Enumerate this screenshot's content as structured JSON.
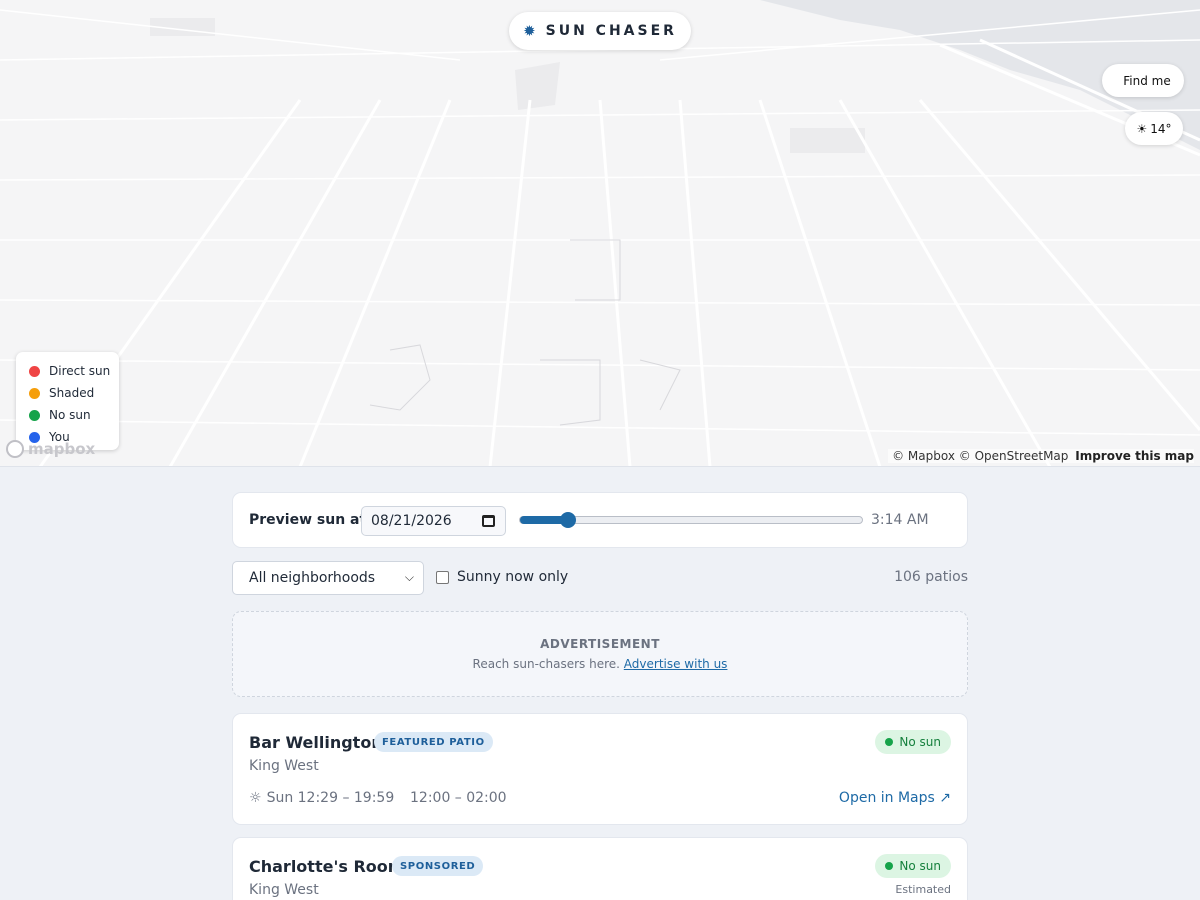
{
  "map": {
    "brand": {
      "icon": "sun-icon",
      "title": "SUN CHASER"
    },
    "find_me_label": "Find me",
    "weather": {
      "icon": "sun-icon",
      "temperature": "14°"
    },
    "legend": [
      {
        "label": "Direct sun",
        "color": "#ef4444"
      },
      {
        "label": "Shaded",
        "color": "#f59e0b"
      },
      {
        "label": "No sun",
        "color": "#16a34a"
      },
      {
        "label": "You",
        "color": "#2563eb"
      }
    ],
    "logo_text": "mapbox",
    "attribution": "© Mapbox © OpenStreetMap",
    "improve_link": "Improve this map"
  },
  "preview": {
    "label": "Preview sun at",
    "date_value": "08/21/2026",
    "slider_fraction": 0.14,
    "time_label": "3:14 AM"
  },
  "filters": {
    "neighborhood_selected": "All neighborhoods",
    "sunny_label": "Sunny now only",
    "sunny_checked": false,
    "count_label": "106 patios"
  },
  "ad": {
    "title": "ADVERTISEMENT",
    "text": "Reach sun-chasers here.",
    "link": "Advertise with us"
  },
  "patios": [
    {
      "name": "Bar Wellington",
      "badge": "FEATURED PATIO",
      "status": "No sun",
      "neighborhood": "King West",
      "sun_hours": "Sun 12:29 – 19:59",
      "open_hours": "12:00 – 02:00",
      "maps_link": "Open in Maps ↗"
    },
    {
      "name": "Charlotte's Room",
      "badge": "SPONSORED",
      "status": "No sun",
      "neighborhood": "King West",
      "note": "Estimated"
    }
  ],
  "colors": {
    "accent": "#1e6aa6",
    "badge_bg": "#dbe9f6",
    "status_green": "#16a34a",
    "status_bg": "#dcf5e3"
  }
}
